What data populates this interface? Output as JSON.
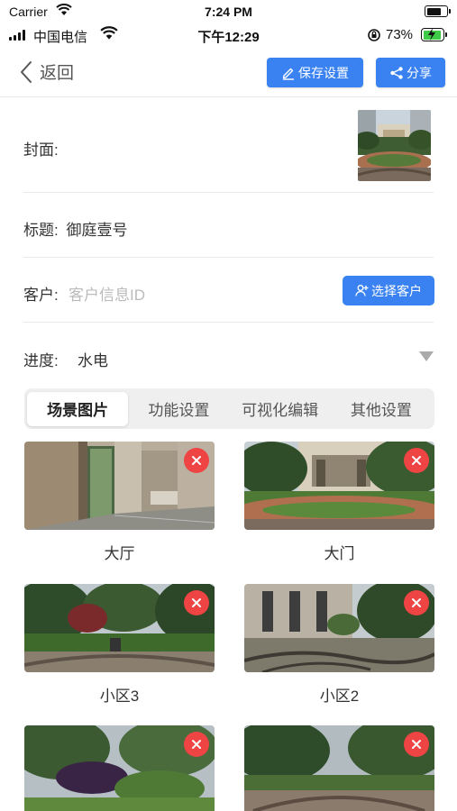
{
  "sim_status": {
    "carrier": "Carrier",
    "time": "7:24 PM"
  },
  "device_status": {
    "carrier": "中国电信",
    "time": "下午12:29",
    "battery": "73%"
  },
  "nav": {
    "back_label": "返回",
    "save_label": "保存设置",
    "share_label": "分享"
  },
  "form": {
    "cover_label": "封面:",
    "title_label": "标题:",
    "title_value": "御庭壹号",
    "client_label": "客户:",
    "client_placeholder": "客户信息ID",
    "select_client_label": "选择客户",
    "progress_label": "进度:",
    "progress_value": "水电"
  },
  "tabs": [
    "场景图片",
    "功能设置",
    "可视化编辑",
    "其他设置"
  ],
  "active_tab": 0,
  "scenes": [
    {
      "label": "大厅"
    },
    {
      "label": "大门"
    },
    {
      "label": "小区3"
    },
    {
      "label": "小区2"
    },
    {
      "label": ""
    },
    {
      "label": ""
    }
  ],
  "colors": {
    "primary": "#3a82f1",
    "delete": "#ee4444",
    "divider": "#e8e8e8"
  }
}
